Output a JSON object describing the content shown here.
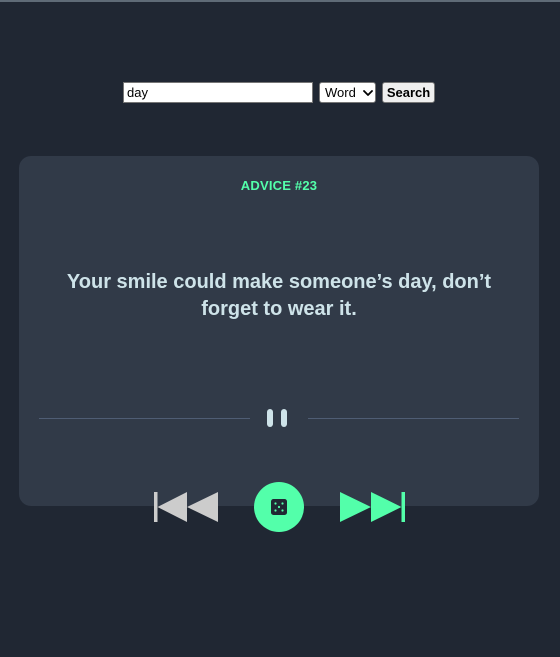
{
  "search": {
    "query_value": "day",
    "mode_selected": "Word",
    "button_label": "Search"
  },
  "advice": {
    "number_label": "ADVICE #23",
    "quote": "Your smile could make someone’s day, don’t forget to wear it."
  },
  "icons": {
    "pause": "pause-icon",
    "previous": "skip-previous-icon",
    "dice": "dice-icon",
    "next": "skip-next-icon",
    "select_arrow": "chevron-down-icon"
  },
  "colors": {
    "background": "#202733",
    "card": "#313a48",
    "accent": "#53ffaa",
    "quote_text": "#cee3e9",
    "divider": "#4f5d74",
    "prev_icon": "#cccccc"
  }
}
